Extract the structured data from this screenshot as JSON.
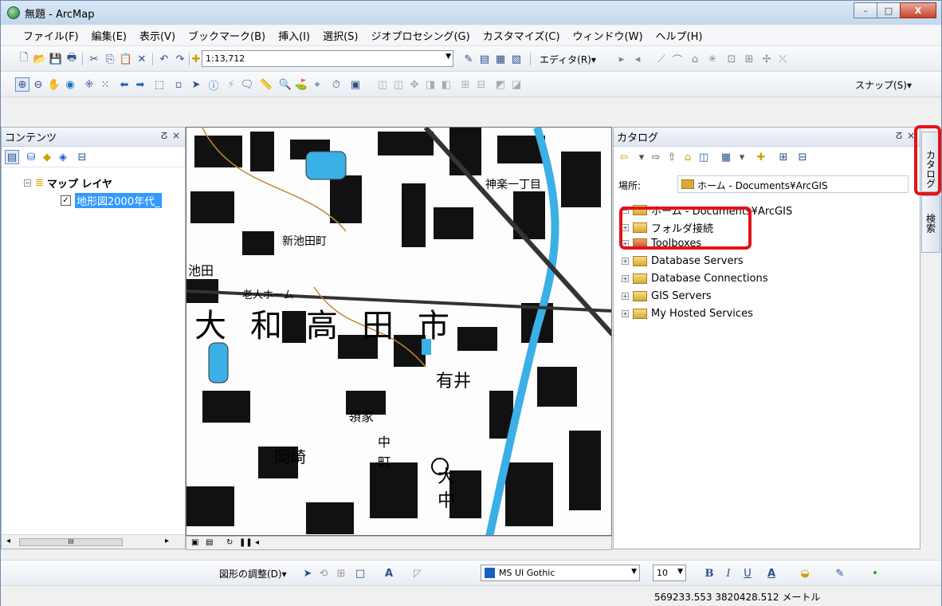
{
  "window": {
    "title": "無題 - ArcMap",
    "minimize": "–",
    "maximize": "□",
    "close": "X"
  },
  "menu": [
    "ファイル(F)",
    "編集(E)",
    "表示(V)",
    "ブックマーク(B)",
    "挿入(I)",
    "選択(S)",
    "ジオプロセシング(G)",
    "カスタマイズ(C)",
    "ウィンドウ(W)",
    "ヘルプ(H)"
  ],
  "toolbar": {
    "scale": "1:13,712",
    "editor": "エディタ(R)▾",
    "snap": "スナップ(S)▾"
  },
  "contents": {
    "title": "コンテンツ",
    "group_label": "マップ レイヤ",
    "layer_label": "地形図2000年代_"
  },
  "catalog": {
    "title": "カタログ",
    "location_label": "場所:",
    "location_value": "ホーム - Documents¥ArcGIS",
    "tree": [
      "ホーム - Documents¥ArcGIS",
      "フォルダ接続",
      "Toolboxes",
      "Database Servers",
      "Database Connections",
      "GIS Servers",
      "My Hosted Services"
    ]
  },
  "sidetabs": {
    "catalog": "カタログ",
    "search": "検索"
  },
  "drawing": {
    "adjust_label": "図形の調整(D)▾",
    "font": "MS UI Gothic",
    "size": "10"
  },
  "status": {
    "coords": "569233.553  3820428.512 メートル"
  },
  "map_labels": [
    "大",
    "和",
    "高",
    "田",
    "市",
    "新池田町",
    "有井",
    "岡崎",
    "老人ホーム",
    "神楽一丁目",
    "池田",
    "領家",
    "中",
    "町",
    "大",
    "中"
  ]
}
